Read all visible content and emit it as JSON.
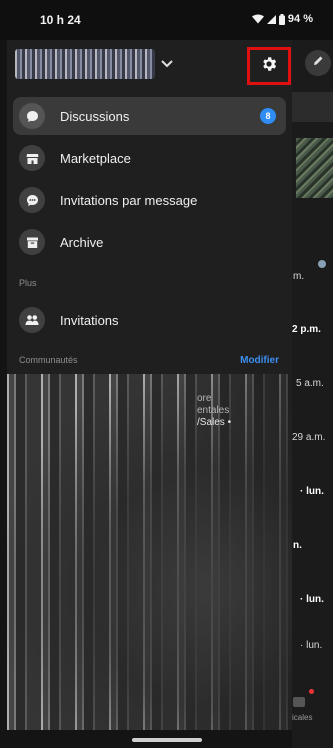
{
  "status_bar": {
    "time": "10 h 24",
    "battery": "94 %"
  },
  "drawer": {
    "menu": [
      {
        "label": "Discussions",
        "icon": "chat-bubble-icon",
        "selected": true,
        "badge": "8"
      },
      {
        "label": "Marketplace",
        "icon": "storefront-icon"
      },
      {
        "label": "Invitations par message",
        "icon": "message-request-icon"
      },
      {
        "label": "Archive",
        "icon": "archive-box-icon"
      }
    ],
    "section_plus": "Plus",
    "plus_items": [
      {
        "label": "Invitations",
        "icon": "people-icon"
      }
    ],
    "section_communities": "Communautés",
    "modify_label": "Modifier",
    "community_text": [
      "ore",
      "entales",
      "/Sales •"
    ]
  },
  "background_list": {
    "items": [
      "m.",
      "2 p.m.",
      "5 a.m.",
      "29 a.m.",
      "· lun.",
      "n.",
      "· lun.",
      "· lun."
    ],
    "footer": "icales"
  }
}
